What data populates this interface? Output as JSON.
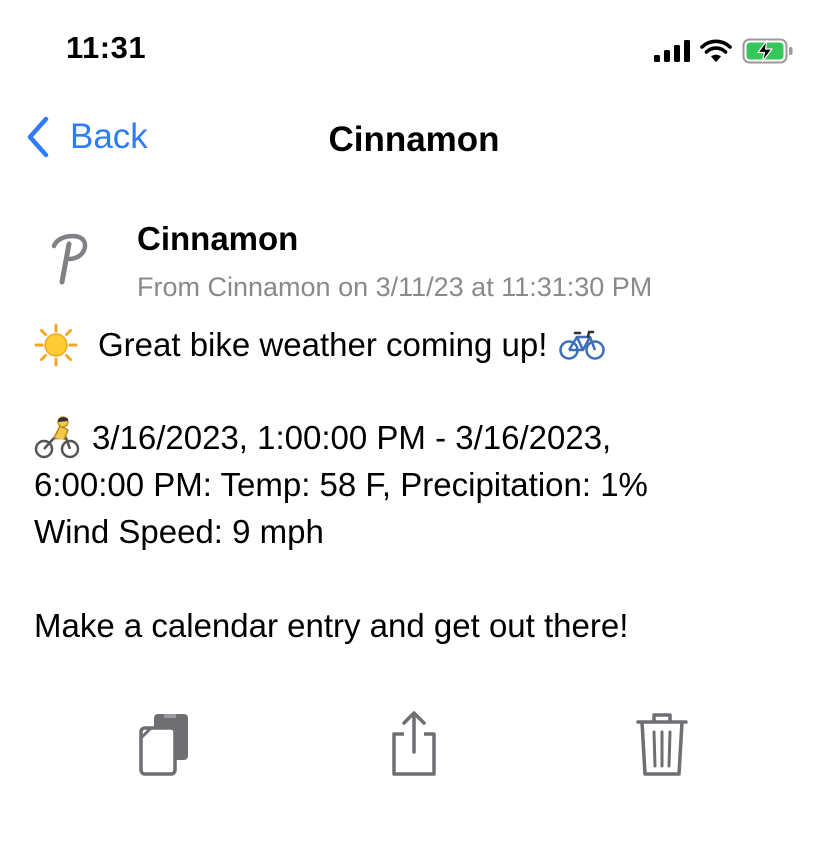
{
  "status_bar": {
    "time": "11:31",
    "icons": [
      "cellular-signal-icon",
      "wifi-icon",
      "battery-charging-icon"
    ],
    "battery_color": "#34c759"
  },
  "nav": {
    "back_label": "Back",
    "title": "Cinnamon",
    "accent_color": "#2f7cf6"
  },
  "message": {
    "sender": "Cinnamon",
    "meta": "From Cinnamon on 3/11/23 at 11:31:30 PM",
    "headline": "Great bike weather coming up!",
    "forecast_line_1": "3/16/2023, 1:00:00 PM - 3/16/2023,",
    "forecast_line_2": "6:00:00 PM: Temp: 58 F, Precipitation: 1%",
    "forecast_line_3": "Wind Speed: 9 mph",
    "closing": "Make a calendar entry and get out there!",
    "emojis": [
      "sun-emoji",
      "bicycle-emoji",
      "cyclist-emoji"
    ]
  },
  "toolbar": {
    "icons": [
      "copy-icon",
      "share-icon",
      "trash-icon"
    ]
  }
}
